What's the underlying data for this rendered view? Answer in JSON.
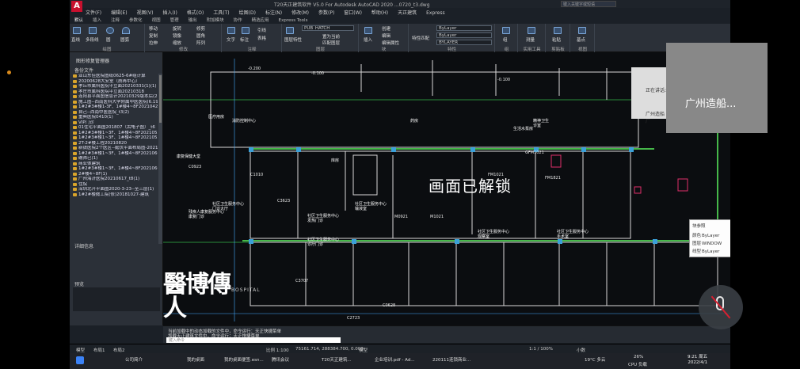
{
  "window": {
    "title": "T20天正建筑软件 V5.0 For Autodesk AutoCAD 2020  ...0720_t3.dwg",
    "app_logo": "A",
    "search_placeholder": "键入关键字或短语"
  },
  "menubar": [
    "文件(F)",
    "编辑(E)",
    "视图(V)",
    "插入(I)",
    "格式(O)",
    "工具(T)",
    "绘图(D)",
    "标注(N)",
    "修改(M)",
    "参数(P)",
    "窗口(W)",
    "帮助(H)",
    "天正建筑",
    "Express"
  ],
  "ribbon_tabs": [
    "默认",
    "插入",
    "注释",
    "参数化",
    "视图",
    "管理",
    "输出",
    "附加模块",
    "协作",
    "精选应用",
    "Express Tools"
  ],
  "ribbon": {
    "draw": {
      "caption": "绘图",
      "items": [
        "直线",
        "多段线",
        "圆",
        "圆弧"
      ]
    },
    "modify": {
      "caption": "修改",
      "items": [
        "移动",
        "旋转",
        "修剪",
        "复制",
        "镜像",
        "圆角",
        "拉伸",
        "缩放",
        "阵列"
      ]
    },
    "annotation": {
      "caption": "注释",
      "items": [
        "文字",
        "标注",
        "引线",
        "表格"
      ]
    },
    "layers": {
      "caption": "图层",
      "layer_name": "PUB_HATCH",
      "items": [
        "图层特性",
        "置为当前",
        "匹配图层"
      ]
    },
    "block": {
      "caption": "块",
      "items": [
        "插入",
        "创建",
        "编辑",
        "编辑属性"
      ]
    },
    "properties": {
      "caption": "特性",
      "items": [
        "特性匹配",
        "ByLayer",
        "ByLayer",
        "BYLAYER"
      ]
    },
    "groups": {
      "caption": "组",
      "items": [
        "组"
      ]
    },
    "utilities": {
      "caption": "实用工具",
      "items": [
        "测量"
      ]
    },
    "clipboard": {
      "caption": "剪贴板",
      "items": [
        "粘贴"
      ]
    },
    "view": {
      "caption": "视图",
      "items": [
        "基点"
      ]
    }
  },
  "left_panel": {
    "title": "图形修复管理器",
    "backup_header": "备份文件",
    "details_header": "详细信息",
    "preview_header": "预览",
    "files": [
      "亚山东佳医院图纸0625-6#组计算",
      "20200628大安室（质再中心）",
      "孝丘市属科医院平立面20210331(1)(1)",
      "孝庄市属科医院平立面20210318",
      "连阳县平面图信息计20210329版本后(2)",
      "施工图--西南医科大学附属中医医院(6.19)",
      "1#2#3#楼1-3F、1#楼4~8F20210420",
      "自己--西南中医医院_t3(2)",
      "重典医院0410(1)",
      "VIP门诊",
      "01住宅平面图201807（古龟子图）_t6",
      "1#2#3#楼1~3F、1#楼4~8F20210520",
      "1#2#3#楼1~3F、1#楼4~8F20210520",
      "2T-2#楼工程20210820",
      "新铁医院2个医区--懿伏平面布局图-2021",
      "1#2#3#楼1~3F、1#楼4~8F20210602",
      "确筛已(1)",
      "商业体建筑",
      "1#2#3#楼1~3F、1#楼4~8F20210602",
      "2#楼4~8F(1)",
      "广州海济医院20210617_t8(1)",
      "住院",
      "深圳北开平面图2020-3-23--至三层(1)",
      "1#2#楼微工院(修)20181027-建筑"
    ]
  },
  "drawing": {
    "overlay_text": "画面已解锁",
    "room_labels": [
      "社区卫生服务中心\n发热门诊",
      "社区卫生服务中心\n诊疗门诊",
      "社区卫生服务中心\n门诊大厅",
      "社区卫生服务中心\n输液室",
      "残疾人康复服务中心\n康复门诊",
      "康复保健大堂",
      "医疗用房",
      "精神卫生\n诊室",
      "生活水泵房",
      "消防控制中心",
      "库房",
      "药房",
      "社区卫生服务中心\n观察室",
      "社区卫生服务中心\n手术室"
    ],
    "dim_labels": [
      "-0.200",
      "-0.100",
      "-0.100",
      "FM1021",
      "FM1821",
      "GFM1021",
      "C0923",
      "C3623",
      "C3707",
      "C2723",
      "C0628",
      "C1010",
      "M1021",
      "M0921"
    ]
  },
  "tooltip": {
    "title": "块参照",
    "rows": [
      {
        "k": "颜色",
        "v": "ByLayer"
      },
      {
        "k": "图层",
        "v": "WINDOW"
      },
      {
        "k": "线型",
        "v": "ByLayer"
      }
    ]
  },
  "command_line": {
    "line1": "当前加载中的动态加载的文件中，命令运行：天正快捷菜单",
    "line2": "加载天正建筑文件中，命令运行：天正快捷菜单",
    "input_placeholder": "键入命令"
  },
  "status_bar": {
    "tabs": [
      "模型",
      "布局1",
      "布局2"
    ],
    "scale": "比例 1:100",
    "coords": "75161.714, 288384.700, 0.000",
    "model": "模型",
    "zoom": "1:1 / 100%",
    "unit": "小数"
  },
  "watermark": {
    "big_text": "醫博傳人",
    "small_text": "BOSPITAL"
  },
  "meeting": {
    "participant_name": "广州造船...",
    "cam_label": "正在讲话:",
    "cam_name": "广州造船厂"
  },
  "taskbar": {
    "items": [
      "公司简介",
      "我的桌面",
      "我的桌面便签.esn...",
      "腾讯会议",
      "T20天正建筑...",
      "企业培训.pdf - Ad...",
      "220111连锁商业..."
    ],
    "weather": "19°C 多云",
    "cpu": "26%",
    "cpu_label": "CPU 负载",
    "time": "9:21 周五",
    "date": "2022/4/1"
  }
}
